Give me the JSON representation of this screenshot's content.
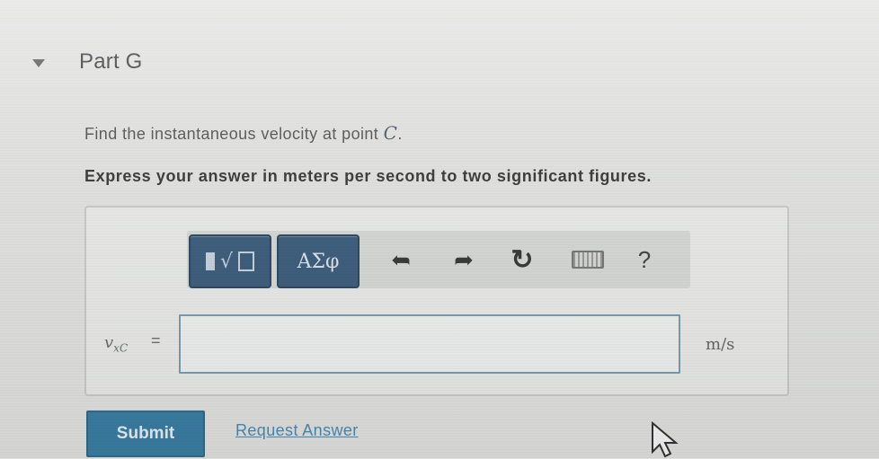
{
  "part": {
    "title": "Part G",
    "expanded_icon": "caret-down-icon"
  },
  "question": {
    "text": "Find the instantaneous velocity at point ",
    "point": "C",
    "period": "."
  },
  "instruction": "Express your answer in meters per second to two significant figures.",
  "toolbar": {
    "templates_icon": "templates-icon",
    "greek_label": "ΑΣφ",
    "undo_icon": "undo-icon",
    "redo_icon": "redo-icon",
    "reset_icon": "reset-icon",
    "keyboard_icon": "keyboard-icon",
    "help_label": "?"
  },
  "answer": {
    "variable": "v",
    "variable_subscript": "xC",
    "equals": "=",
    "value": "",
    "unit": "m/s"
  },
  "actions": {
    "submit_label": "Submit",
    "request_answer_label": "Request Answer"
  },
  "colors": {
    "primary_button": "#3a7da2",
    "toolbar_button": "#3f5f7d",
    "link": "#4a8ab0",
    "input_border": "#7b9cae"
  }
}
